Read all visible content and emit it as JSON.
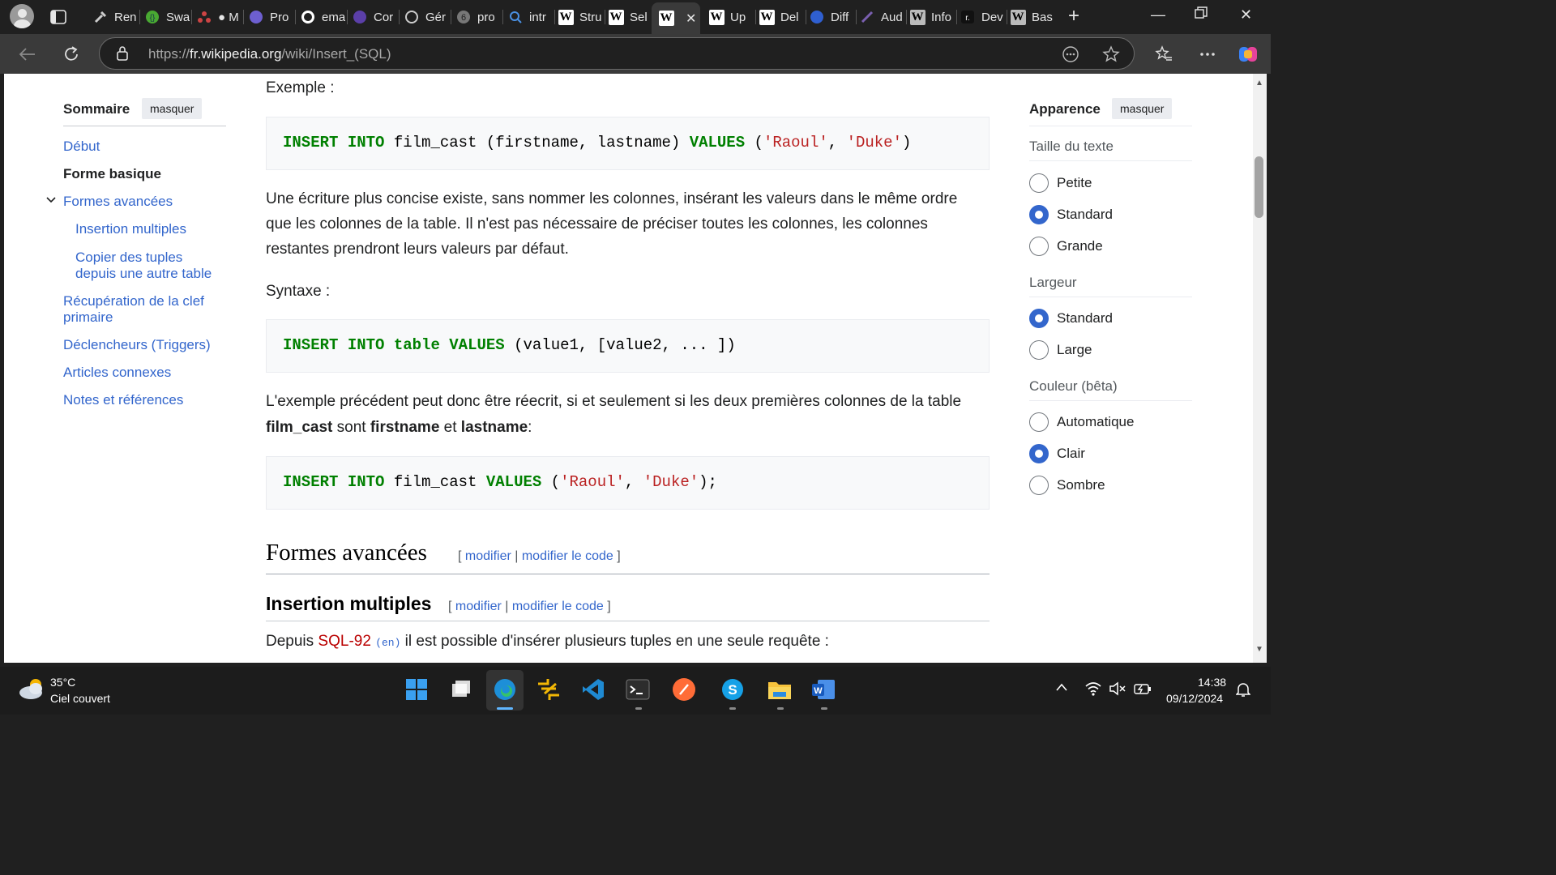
{
  "browser": {
    "tabs": [
      {
        "label": "Ren"
      },
      {
        "label": "Swa"
      },
      {
        "label": "● M"
      },
      {
        "label": "Pro"
      },
      {
        "label": "ema"
      },
      {
        "label": "Cor"
      },
      {
        "label": "Gér"
      },
      {
        "label": "pro"
      },
      {
        "label": "intr"
      },
      {
        "label": "Stru"
      },
      {
        "label": "Sel"
      },
      {
        "label": ""
      },
      {
        "label": "Up"
      },
      {
        "label": "Del"
      },
      {
        "label": "Diff"
      },
      {
        "label": "Aud"
      },
      {
        "label": "Info"
      },
      {
        "label": "Dev"
      },
      {
        "label": "Bas"
      }
    ],
    "url_prefix": "https://",
    "url_host": "fr.wikipedia.org",
    "url_path": "/wiki/Insert_(SQL)"
  },
  "toc": {
    "title": "Sommaire",
    "hide_label": "masquer",
    "items": [
      {
        "label": "Début"
      },
      {
        "label": "Forme basique"
      },
      {
        "label": "Formes avancées"
      },
      {
        "label": "Insertion multiples"
      },
      {
        "label": "Copier des tuples"
      },
      {
        "label": "depuis une autre table"
      },
      {
        "label": "Récupération de la clef"
      },
      {
        "label": "primaire"
      },
      {
        "label": "Déclencheurs (Triggers)"
      },
      {
        "label": "Articles connexes"
      },
      {
        "label": "Notes et références"
      }
    ]
  },
  "article": {
    "example_label": "Exemple :",
    "code1": {
      "kw1": "INSERT",
      "kw2": "INTO",
      "t1": " film_cast (firstname, lastname) ",
      "kw3": "VALUES",
      "t2": " (",
      "s1": "'Raoul'",
      "t3": ", ",
      "s2": "'Duke'",
      "t4": ")"
    },
    "para1_line1": "Une écriture plus concise existe, sans nommer les colonnes, insérant les valeurs dans le même ordre",
    "para1_line2": "que les colonnes de la table. Il n'est pas nécessaire de préciser toutes les colonnes, les colonnes",
    "para1_line3": "restantes prendront leurs valeurs par défaut.",
    "syntax_label": "Syntaxe :",
    "code2": {
      "kw1": "INSERT",
      "kw2": "INTO",
      "kw3": "table",
      "kw4": "VALUES",
      "t1": " (value1, [value2, ... ])"
    },
    "para2_line1": "L'exemple précédent peut donc être réecrit, si et seulement si les deux premières colonnes de la table",
    "para2_b1": "film_cast",
    "para2_t1": " sont ",
    "para2_b2": "firstname",
    "para2_t2": " et ",
    "para2_b3": "lastname",
    "para2_t3": ":",
    "code3": {
      "kw1": "INSERT",
      "kw2": "INTO",
      "t1": " film_cast ",
      "kw3": "VALUES",
      "t2": " (",
      "s1": "'Raoul'",
      "t3": ", ",
      "s2": "'Duke'",
      "t4": ");"
    },
    "h2": "Formes avancées",
    "h2_edit": "modifier",
    "h2_edit_code": "modifier le code",
    "h3": "Insertion multiples",
    "h3_edit": "modifier",
    "h3_edit_code": "modifier le code",
    "para3_t1": "Depuis ",
    "para3_link": "SQL-92",
    "para3_lang": "(en)",
    "para3_t2": " il est possible d'insérer plusieurs tuples en une seule requête :"
  },
  "appearance": {
    "title": "Apparence",
    "hide_label": "masquer",
    "text_size_label": "Taille du texte",
    "text_size_options": [
      "Petite",
      "Standard",
      "Grande"
    ],
    "text_size_selected": "Standard",
    "width_label": "Largeur",
    "width_options": [
      "Standard",
      "Large"
    ],
    "width_selected": "Standard",
    "color_label": "Couleur (bêta)",
    "color_options": [
      "Automatique",
      "Clair",
      "Sombre"
    ],
    "color_selected": "Clair",
    "accent": "#3366cc"
  },
  "taskbar": {
    "temperature": "35°C",
    "weather": "Ciel couvert",
    "time": "14:38",
    "date": "09/12/2024"
  }
}
